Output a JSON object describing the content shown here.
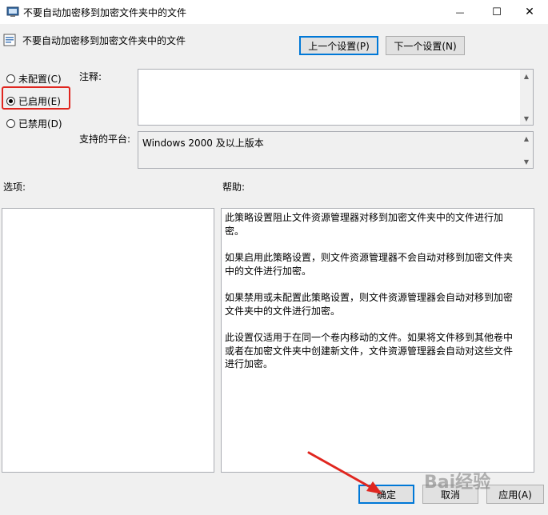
{
  "window": {
    "title": "不要自动加密移到加密文件夹中的文件",
    "minimize_glyph": "—",
    "maximize_glyph": "☐",
    "close_glyph": "✕"
  },
  "header": {
    "policy_title": "不要自动加密移到加密文件夹中的文件",
    "prev_button": "上一个设置(P)",
    "next_button": "下一个设置(N)"
  },
  "state": {
    "not_configured": "未配置(C)",
    "enabled": "已启用(E)",
    "disabled": "已禁用(D)",
    "selected": "enabled"
  },
  "comment": {
    "label": "注释:",
    "value": ""
  },
  "platform": {
    "label": "支持的平台:",
    "value": "Windows 2000 及以上版本"
  },
  "options": {
    "label": "选项:"
  },
  "help": {
    "label": "帮助:",
    "paragraphs": [
      "此策略设置阻止文件资源管理器对移到加密文件夹中的文件进行加密。",
      "如果启用此策略设置，则文件资源管理器不会自动对移到加密文件夹中的文件进行加密。",
      "如果禁用或未配置此策略设置，则文件资源管理器会自动对移到加密文件夹中的文件进行加密。",
      "此设置仅适用于在同一个卷内移动的文件。如果将文件移到其他卷中或者在加密文件夹中创建新文件，文件资源管理器会自动对这些文件进行加密。"
    ]
  },
  "footer": {
    "ok_button": "确定",
    "cancel_button": "取消",
    "apply_button": "应用(A)"
  },
  "watermark": "Bai经验",
  "colors": {
    "highlight": "#e0261f",
    "accent": "#0078d7"
  }
}
